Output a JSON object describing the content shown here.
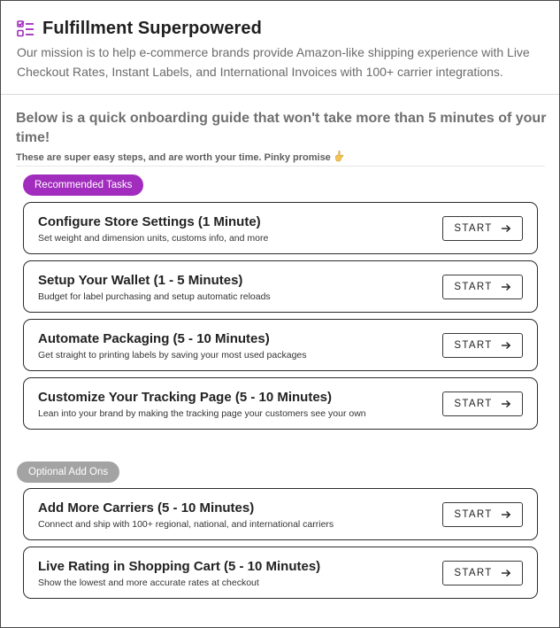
{
  "header": {
    "title": "Fulfillment Superpowered",
    "mission": "Our mission is to help e-commerce brands provide Amazon-like shipping experience with Live Checkout Rates, Instant Labels, and International Invoices with 100+ carrier integrations.",
    "icon": "checklist-icon",
    "accent_color": "#a12cbd"
  },
  "guide": {
    "heading": "Below is a quick onboarding guide that won't take more than 5 minutes of your time!",
    "subtext": "These are super easy steps, and are worth your time. Pinky promise",
    "subtext_icon": "pinky-promise-hand-icon"
  },
  "recommended": {
    "label": "Recommended Tasks",
    "color": "#a12cbd",
    "tasks": [
      {
        "title": "Configure Store Settings (1 Minute)",
        "description": "Set weight and dimension units, customs info, and more",
        "button": "START"
      },
      {
        "title": "Setup Your Wallet (1 - 5 Minutes)",
        "description": "Budget for label purchasing and setup automatic reloads",
        "button": "START"
      },
      {
        "title": "Automate Packaging (5 - 10 Minutes)",
        "description": "Get straight to printing labels by saving your most used packages",
        "button": "START"
      },
      {
        "title": "Customize Your Tracking Page (5 - 10 Minutes)",
        "description": "Lean into your brand by making the tracking page your customers see your own",
        "button": "START"
      }
    ]
  },
  "optional": {
    "label": "Optional Add Ons",
    "color": "#a3a3a3",
    "tasks": [
      {
        "title": "Add More Carriers (5 - 10 Minutes)",
        "description": "Connect and ship with 100+ regional, national, and international carriers",
        "button": "START"
      },
      {
        "title": "Live Rating in Shopping Cart (5 - 10 Minutes)",
        "description": "Show the lowest and more accurate rates at checkout",
        "button": "START"
      }
    ]
  }
}
